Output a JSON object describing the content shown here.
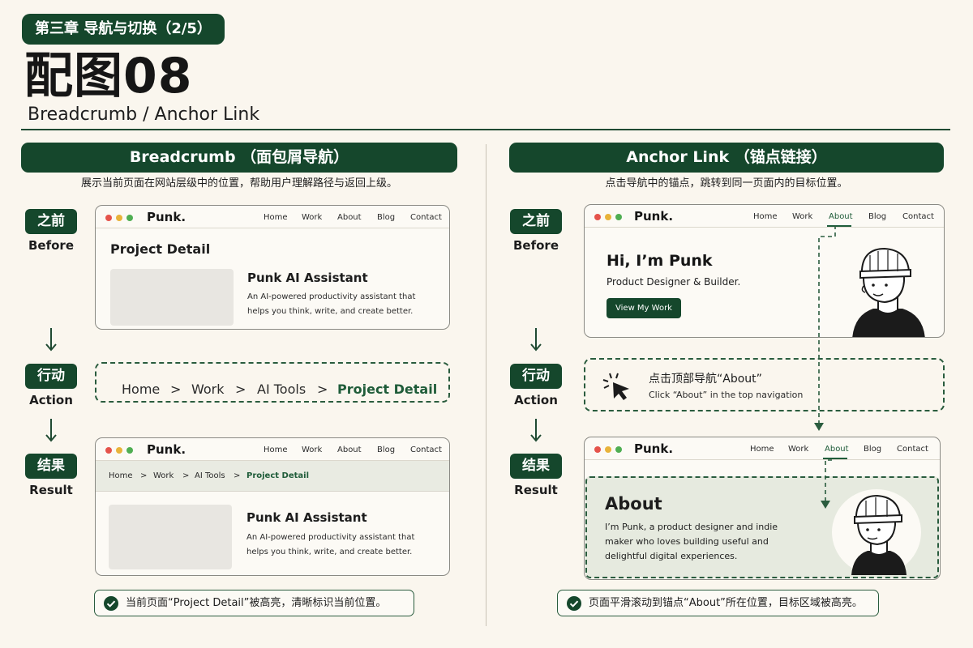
{
  "header": {
    "chapter": "第三章  导航与切换（2/5）",
    "title": "配图08",
    "subtitle": "Breadcrumb / Anchor Link"
  },
  "steps": {
    "before_cn": "之前",
    "before_en": "Before",
    "action_cn": "行动",
    "action_en": "Action",
    "result_cn": "结果",
    "result_en": "Result"
  },
  "site": {
    "brand": "Punk.",
    "nav": [
      "Home",
      "Work",
      "About",
      "Blog",
      "Contact"
    ]
  },
  "breadcrumb_panel": {
    "header": "Breadcrumb （面包屑导航）",
    "description": "展示当前页面在网站层级中的位置，帮助用户理解路径与返回上级。",
    "page_heading": "Project Detail",
    "card_title": "Punk AI Assistant",
    "card_desc": "An AI-powered productivity assistant that helps you think, write, and create better.",
    "crumbs": [
      "Home",
      "Work",
      "AI Tools",
      "Project Detail"
    ],
    "separator": ">",
    "result_note": "当前页面“Project Detail”被高亮，清晰标识当前位置。"
  },
  "anchor_panel": {
    "header": "Anchor Link （锚点链接）",
    "description": "点击导航中的锚点，跳转到同一页面内的目标位置。",
    "hero_title": "Hi, I’m Punk",
    "hero_sub": "Product Designer & Builder.",
    "cta": "View My Work",
    "action_cn": "点击顶部导航“About”",
    "action_en": "Click “About” in the top navigation",
    "about_title": "About",
    "about_body": "I’m Punk, a product designer and indie maker who loves building useful and delightful digital experiences.",
    "active_nav": "About",
    "result_note": "页面平滑滚动到锚点“About”所在位置，目标区域被高亮。"
  },
  "colors": {
    "accent": "#15472c",
    "background": "#faf6ee",
    "highlight": "#e6eadf"
  }
}
